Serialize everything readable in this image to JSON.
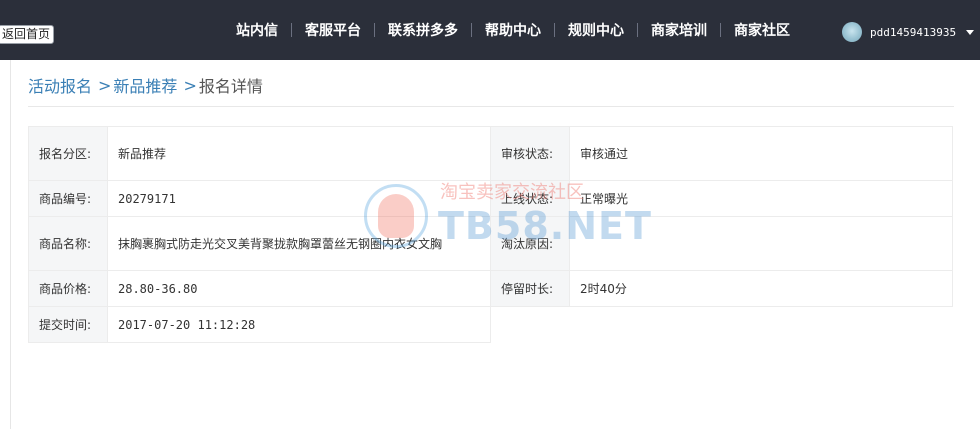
{
  "topbar": {
    "back_label": "返回首页",
    "nav": [
      "站内信",
      "客服平台",
      "联系拼多多",
      "帮助中心",
      "规则中心",
      "商家培训",
      "商家社区"
    ],
    "username": "pdd1459413935"
  },
  "breadcrumb": {
    "item1": "活动报名",
    "item2": "新品推荐",
    "current": "报名详情",
    "sep1": ">",
    "sep2": ">"
  },
  "details_left": [
    {
      "label": "报名分区:",
      "value": "新品推荐"
    },
    {
      "label": "商品编号:",
      "value": "20279171"
    },
    {
      "label": "商品名称:",
      "value": "抹胸裹胸式防走光交叉美背聚拢款胸罩蕾丝无钢圈内衣女文胸"
    },
    {
      "label": "商品价格:",
      "value": "28.80-36.80"
    },
    {
      "label": "提交时间:",
      "value": "2017-07-20 11:12:28"
    }
  ],
  "details_right": [
    {
      "label": "审核状态:",
      "value": "审核通过"
    },
    {
      "label": "上线状态:",
      "value": "正常曝光"
    },
    {
      "label": "淘汰原因:",
      "value": ""
    },
    {
      "label": "停留时长:",
      "value": "2时40分"
    }
  ],
  "watermark": {
    "cn": "淘宝卖家交流社区",
    "en": "TB58.NET"
  },
  "colors": {
    "topbar_bg": "#2b2f3a",
    "link": "#3a7fb5",
    "label_bg": "#f5f6f7"
  },
  "icons": {
    "avatar": "avatar",
    "dropdown": "caret-down-icon"
  }
}
